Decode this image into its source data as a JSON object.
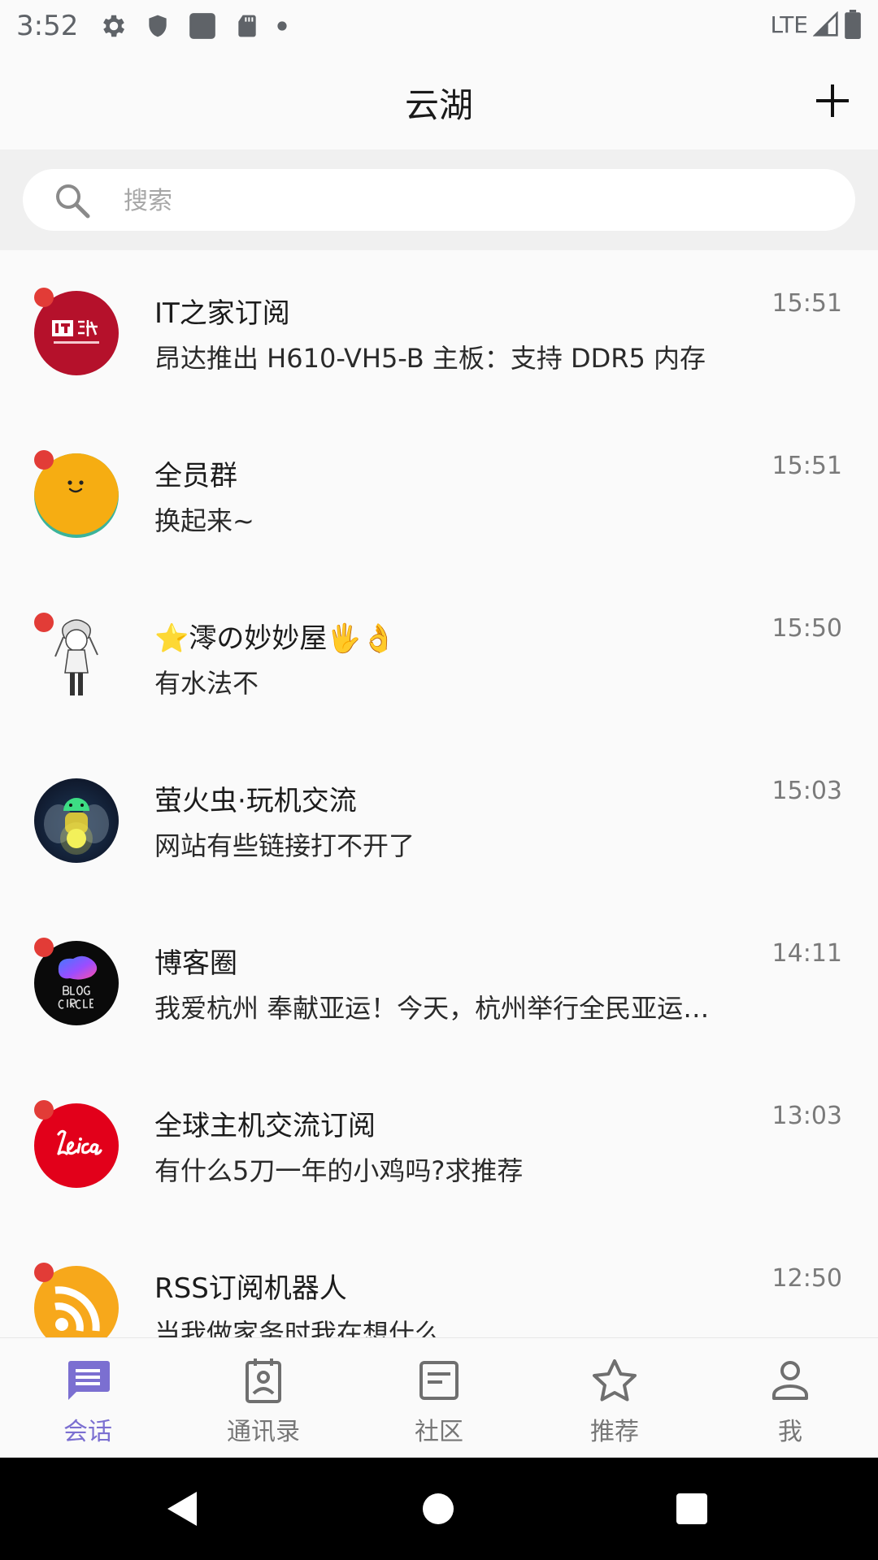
{
  "status_bar": {
    "time": "3:52",
    "network": "LTE",
    "icons": [
      "gear-icon",
      "shield-icon",
      "square-icon",
      "sd-card-icon",
      "dot-icon",
      "signal-icon",
      "battery-icon"
    ]
  },
  "app_bar": {
    "title": "云湖",
    "add_icon": "plus-icon"
  },
  "search": {
    "placeholder": "搜索",
    "icon": "search-icon"
  },
  "conversations": [
    {
      "name": "IT之家订阅",
      "preview": "昂达推出 H610-VH5-B 主板：支持 DDR5 内存",
      "time": "15:51",
      "unread": true,
      "avatar": "ithome-logo"
    },
    {
      "name": "全员群",
      "preview": "换起来~",
      "time": "15:51",
      "unread": true,
      "avatar": "smiley-face"
    },
    {
      "name": "⭐澪の妙妙屋🖐👌",
      "preview": "有水法不",
      "time": "15:50",
      "unread": true,
      "avatar": "anime-character"
    },
    {
      "name": "萤火虫·玩机交流",
      "preview": "网站有些链接打不开了",
      "time": "15:03",
      "unread": false,
      "avatar": "firefly-android"
    },
    {
      "name": "博客圈",
      "preview": "我爱杭州 奉献亚运！今天，杭州举行全民亚运活动",
      "time": "14:11",
      "unread": true,
      "avatar": "blog-circle-logo"
    },
    {
      "name": "全球主机交流订阅",
      "preview": "有什么5刀一年的小鸡吗?求推荐",
      "time": "13:03",
      "unread": true,
      "avatar": "leica-logo"
    },
    {
      "name": "RSS订阅机器人",
      "preview": "当我做家务时我在想什么",
      "time": "12:50",
      "unread": true,
      "avatar": "rss-icon"
    }
  ],
  "bottom_nav": {
    "items": [
      {
        "label": "会话",
        "icon": "chat-icon",
        "active": true
      },
      {
        "label": "通讯录",
        "icon": "contacts-icon",
        "active": false
      },
      {
        "label": "社区",
        "icon": "community-icon",
        "active": false
      },
      {
        "label": "推荐",
        "icon": "star-icon",
        "active": false
      },
      {
        "label": "我",
        "icon": "person-icon",
        "active": false
      }
    ]
  },
  "colors": {
    "accent": "#7b6fd1",
    "unread_dot": "#e23c37",
    "background": "#fafafa",
    "search_background": "#f0f0f0"
  }
}
